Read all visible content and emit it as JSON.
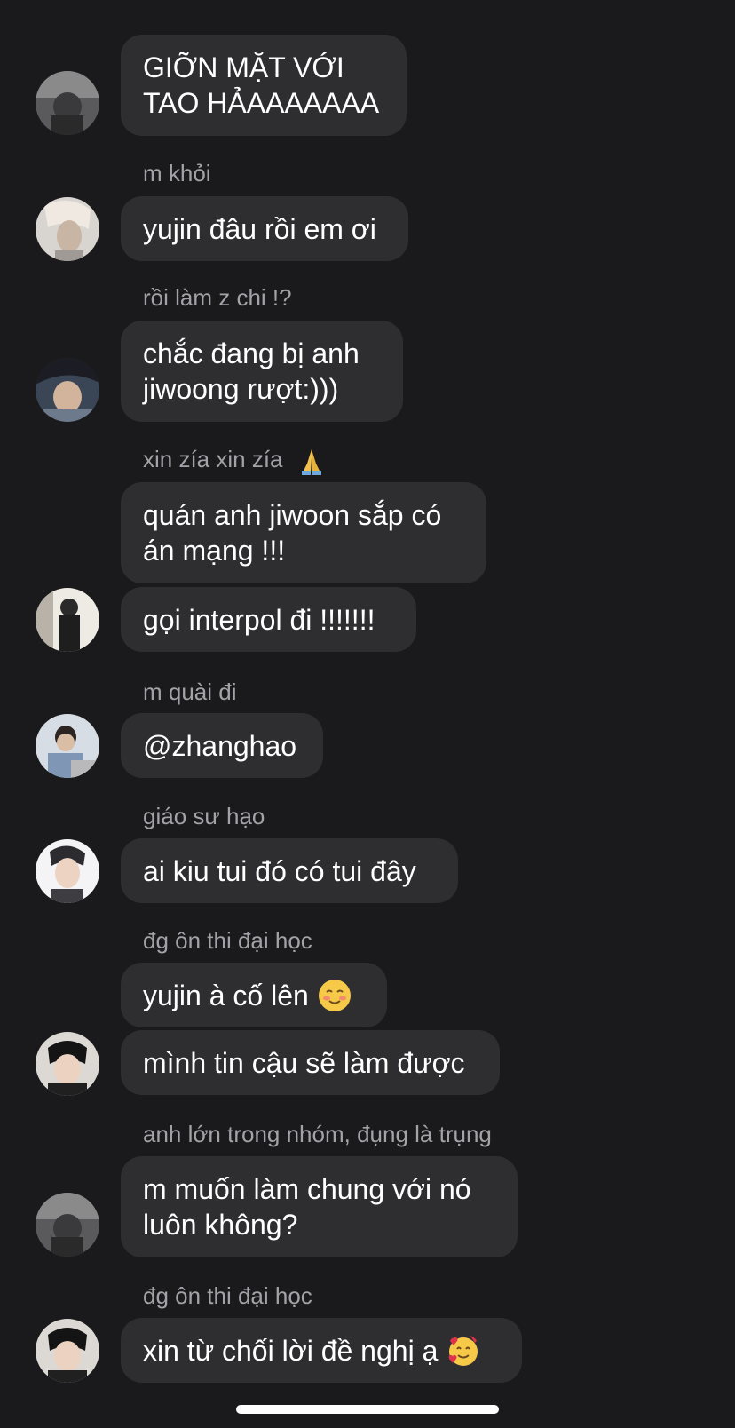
{
  "messages": [
    {
      "sender": "",
      "text": "GIỠN MẶT VỚI\nTAO HẢAAAAAAA"
    },
    {
      "sender": "m khỏi",
      "text": "yujin đâu rồi em ơi"
    },
    {
      "sender": "rồi làm z chi !?",
      "text": "chắc đang bị anh\njiwoong rượt:)))"
    },
    {
      "sender": "xin zía xin zía",
      "text": "quán anh jiwoon sắp có\nán mạng !!!"
    },
    {
      "sender": "",
      "text": "gọi interpol đi !!!!!!!"
    },
    {
      "sender": "m quài đi",
      "text": "@zhanghao"
    },
    {
      "sender": "giáo sư hạo",
      "text": "ai kiu tui đó có tui đây"
    },
    {
      "sender": "đg ôn thi đại học",
      "text": "yujin à cố lên"
    },
    {
      "sender": "",
      "text": "mình tin cậu sẽ làm được"
    },
    {
      "sender": "anh lớn trong nhóm, đụng là trụng",
      "text": "m muốn làm chung với nó\nluôn không?"
    },
    {
      "sender": "đg ôn thi đại học",
      "text": "xin từ chối lời đề nghị ạ"
    }
  ],
  "icons": {
    "pray": "folded-hands-emoji",
    "smile": "smiling-blush-emoji",
    "hearts": "smiling-face-with-hearts-emoji",
    "home": "home-indicator"
  },
  "colors": {
    "background": "#1a1a1c",
    "bubble": "#2e2e30",
    "sender_text": "#a2a2a8"
  }
}
